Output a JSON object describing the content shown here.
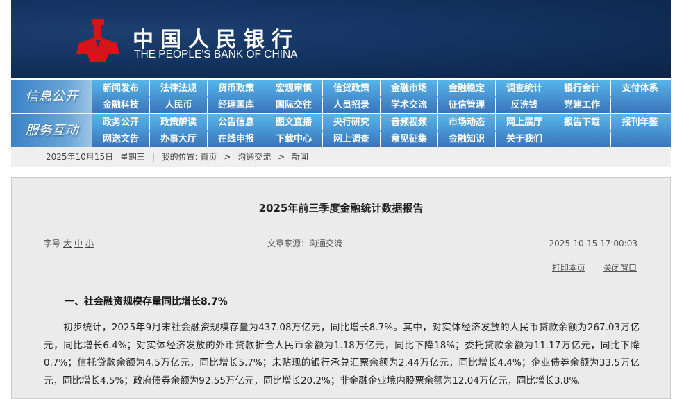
{
  "header": {
    "logo_cn": "中国人民银行",
    "logo_en": "THE PEOPLE'S BANK OF CHINA",
    "logo_color": "#d7141a"
  },
  "nav": [
    {
      "label": "信息公开",
      "items": [
        "新闻发布",
        "法律法规",
        "货币政策",
        "宏观审慎",
        "信贷政策",
        "金融市场",
        "金融稳定",
        "调查统计",
        "银行会计",
        "支付体系",
        "金融科技",
        "人民币",
        "经理国库",
        "国际交往",
        "人员招录",
        "学术交流",
        "征信管理",
        "反洗钱",
        "党建工作",
        ""
      ]
    },
    {
      "label": "服务互动",
      "items": [
        "政务公开",
        "政策解读",
        "公告信息",
        "图文直播",
        "央行研究",
        "音频视频",
        "市场动态",
        "网上展厅",
        "报告下载",
        "报刊年鉴",
        "网送文告",
        "办事大厅",
        "在线申报",
        "下载中心",
        "网上调查",
        "意见征集",
        "金融知识",
        "关于我们",
        "",
        ""
      ]
    }
  ],
  "breadcrumb": {
    "date": "2025年10月15日",
    "weekday": "星期三",
    "sep": "|",
    "location_label": "我的位置:",
    "items": [
      "首页",
      ">",
      "沟通交流",
      ">",
      "新闻"
    ]
  },
  "article": {
    "title": "2025年前三季度金融统计数据报告",
    "font_size_label": "字号",
    "font_sizes": [
      "大",
      "中",
      "小"
    ],
    "source": "文章来源：沟通交流",
    "datetime": "2025-10-15 17:00:03",
    "print": "打印本页",
    "close": "关闭窗口",
    "heading": "一、社会融资规模存量同比增长8.7%",
    "paragraph": "初步统计，2025年9月末社会融资规模存量为437.08万亿元，同比增长8.7%。其中，对实体经济发放的人民币贷款余额为267.03万亿元，同比增长6.4%；对实体经济发放的外币贷款折合人民币余额为1.18万亿元，同比下降18%；委托贷款余额为11.17万亿元，同比下降0.7%；信托贷款余额为4.5万亿元，同比增长5.7%；未贴现的银行承兑汇票余额为2.44万亿元，同比增长4.4%；企业债券余额为33.5万亿元，同比增长4.5%；政府债券余额为92.55万亿元，同比增长20.2%；非金融企业境内股票余额为12.04万亿元，同比增长3.8%。"
  }
}
